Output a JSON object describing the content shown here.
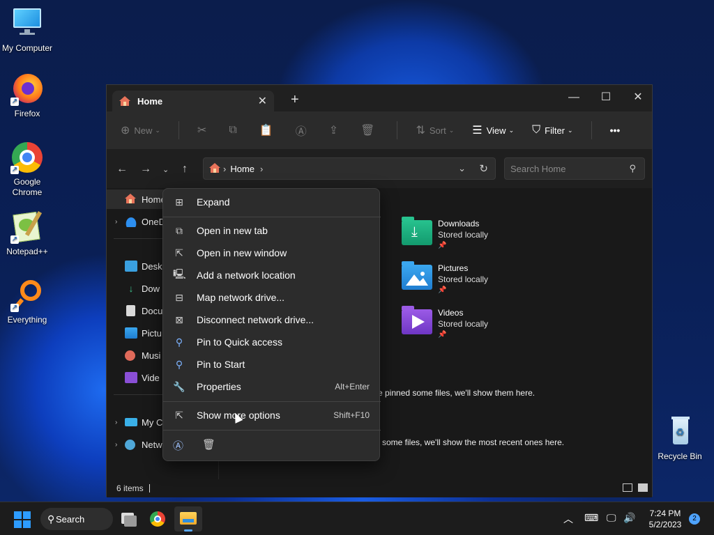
{
  "desktop": {
    "icons": [
      {
        "label": "My Computer",
        "icon": "monitor-icon"
      },
      {
        "label": "Firefox",
        "icon": "firefox-icon"
      },
      {
        "label": "Google Chrome",
        "icon": "chrome-icon"
      },
      {
        "label": "Notepad++",
        "icon": "notepadpp-icon"
      },
      {
        "label": "Everything",
        "icon": "everything-icon"
      },
      {
        "label": "Recycle Bin",
        "icon": "recycle-bin-icon"
      }
    ]
  },
  "window": {
    "tab_title": "Home",
    "toolbar": {
      "new_label": "New",
      "sort_label": "Sort",
      "view_label": "View",
      "filter_label": "Filter",
      "more_label": "•••"
    },
    "address": {
      "crumb": "Home"
    },
    "search": {
      "placeholder": "Search Home"
    },
    "nav_items": [
      {
        "label": "Home"
      },
      {
        "label": "OneD"
      },
      {
        "label": "Desk"
      },
      {
        "label": "Dow"
      },
      {
        "label": "Docu"
      },
      {
        "label": "Pictu"
      },
      {
        "label": "Musi"
      },
      {
        "label": "Vide"
      },
      {
        "label": "My C"
      },
      {
        "label": "Netw"
      }
    ],
    "folders": [
      {
        "name": "Downloads",
        "status": "Stored locally"
      },
      {
        "name": "Pictures",
        "status": "Stored locally"
      },
      {
        "name": "Videos",
        "status": "Stored locally"
      }
    ],
    "messages": {
      "favorites": "e pinned some files, we'll show them here.",
      "recent": "l some files, we'll show the most recent ones here."
    },
    "status": {
      "item_count": "6 items"
    }
  },
  "context_menu": {
    "items": [
      {
        "label": "Expand",
        "icon": "expand-icon",
        "shortcut": ""
      },
      {
        "label": "Open in new tab",
        "icon": "open-new-tab-icon",
        "shortcut": ""
      },
      {
        "label": "Open in new window",
        "icon": "open-new-window-icon",
        "shortcut": ""
      },
      {
        "label": "Add a network location",
        "icon": "network-location-icon",
        "shortcut": ""
      },
      {
        "label": "Map network drive...",
        "icon": "map-drive-icon",
        "shortcut": ""
      },
      {
        "label": "Disconnect network drive...",
        "icon": "disconnect-drive-icon",
        "shortcut": ""
      },
      {
        "label": "Pin to Quick access",
        "icon": "pin-icon",
        "shortcut": ""
      },
      {
        "label": "Pin to Start",
        "icon": "pin-start-icon",
        "shortcut": ""
      },
      {
        "label": "Properties",
        "icon": "wrench-icon",
        "shortcut": "Alt+Enter"
      },
      {
        "label": "Show more options",
        "icon": "more-options-icon",
        "shortcut": "Shift+F10"
      }
    ]
  },
  "taskbar": {
    "search_label": "Search",
    "time": "7:24 PM",
    "date": "5/2/2023",
    "notification_count": "2"
  },
  "colors": {
    "accent": "#2d9cff",
    "window_bg": "#191919",
    "menu_bg": "#2c2c2c"
  }
}
